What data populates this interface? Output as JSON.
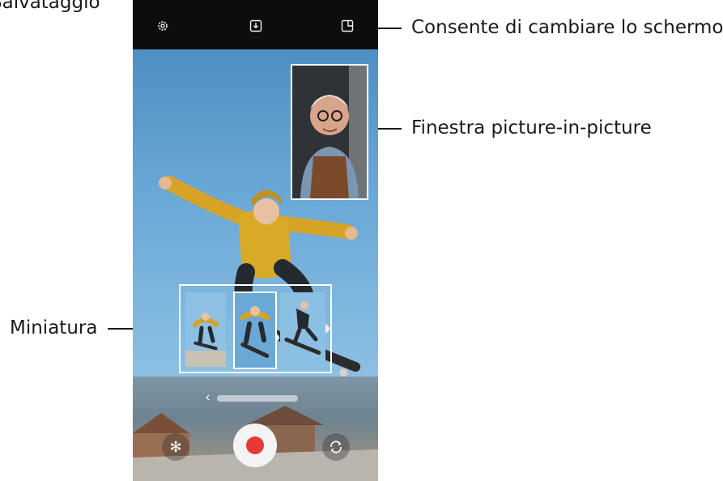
{
  "callouts": {
    "save": "Salvataggio",
    "switch_screen": "Consente di cambiare lo schermo",
    "pip_window": "Finestra picture-in-picture",
    "thumbnail": "Miniatura"
  },
  "camera": {
    "top_icons": [
      "gear-icon",
      "download-icon",
      "screen-switch-icon"
    ],
    "bottom_icons": [
      "effects-icon",
      "record-button",
      "flip-camera-icon"
    ],
    "colors": {
      "record": "#e53935",
      "topbar": "#0d0d0d"
    }
  }
}
